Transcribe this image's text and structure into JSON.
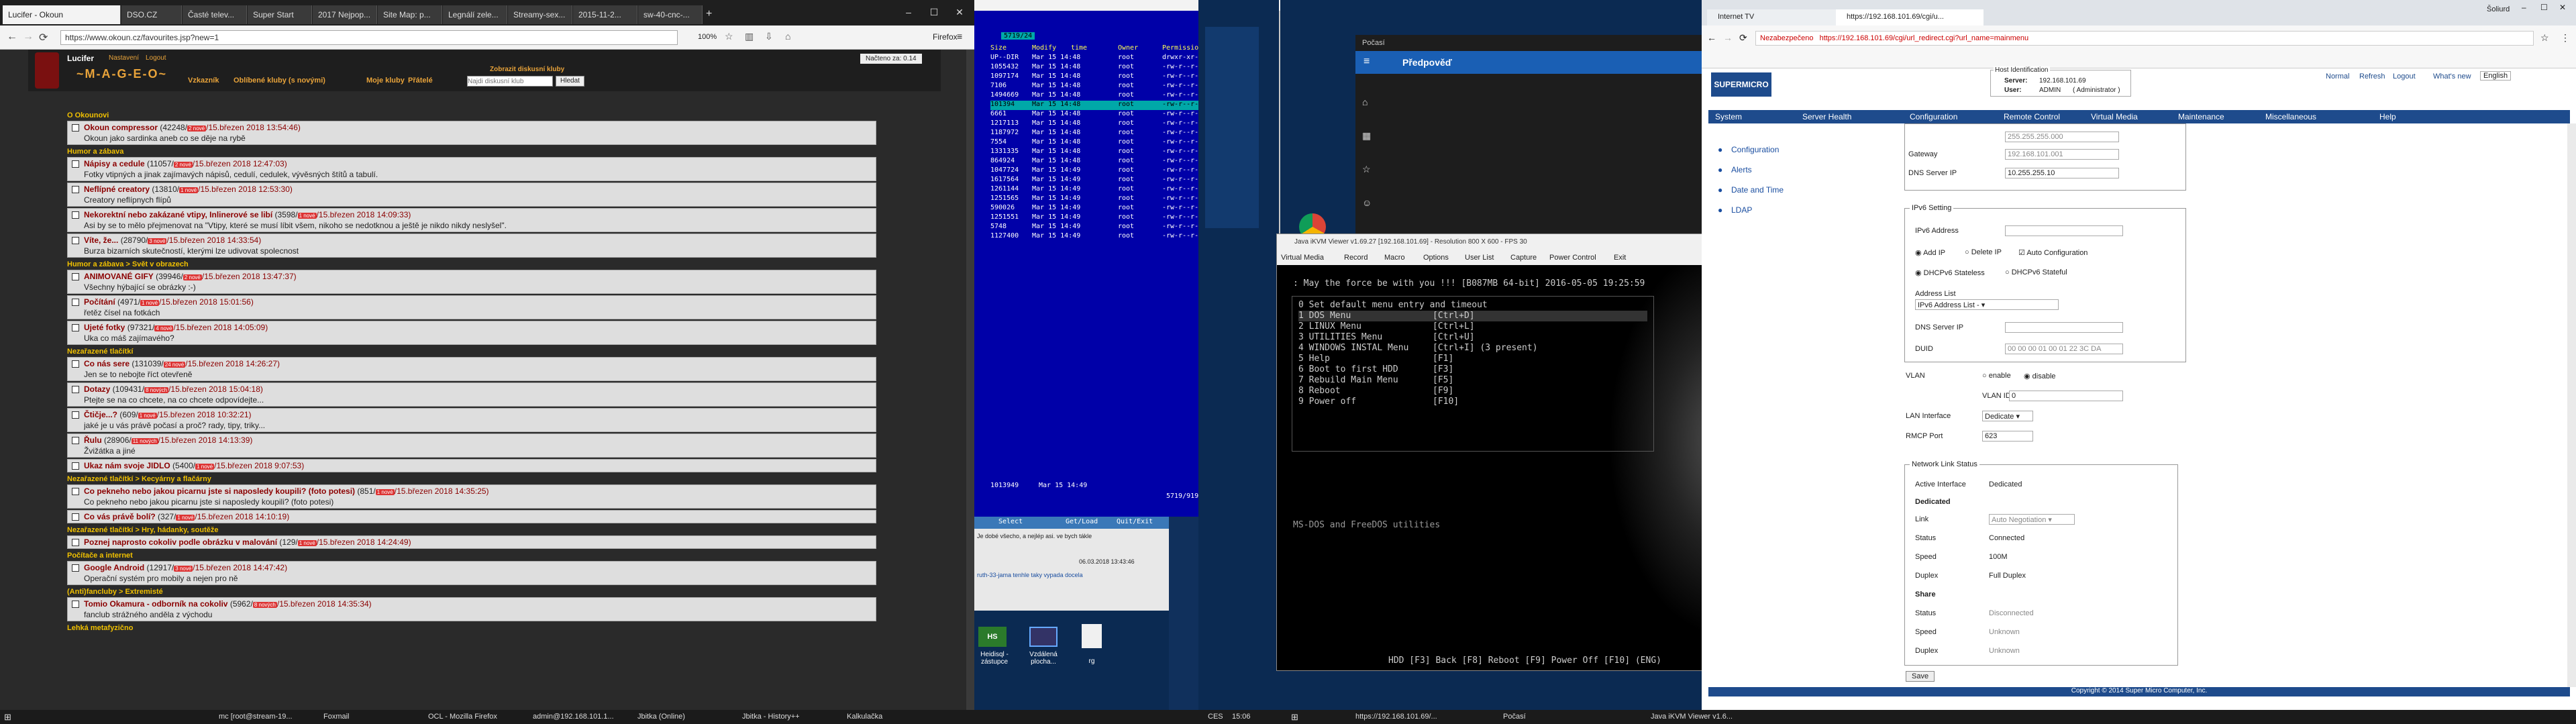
{
  "colors": {
    "okoun_bg": "#2a2a2a",
    "fm_blue": "#0000a8",
    "fm_cyan": "#00a8a8",
    "kvm_bg": "#000000",
    "sm_nav": "#1e4b8c",
    "accent": "#d33"
  },
  "ff1": {
    "tabs": [
      "Lucifer - Okoun",
      "DSO.CZ",
      "Časté telev...",
      "Super Start",
      "2017 Nejpop...",
      "Site Map: p...",
      "Legnálí zele...",
      "Streamy-sex...",
      "2015-11-2...",
      "sw-40-cnc-..."
    ],
    "url": "https://www.okoun.cz/favourites.jsp?new=1",
    "zoom": "100%",
    "toolbar_right": "Firefox",
    "user": "Lucifer",
    "logo": "~M-A-G-E-O~",
    "top_links": [
      "Nastavení",
      "Logout"
    ],
    "menu": [
      "Vzkazník",
      "Oblíbené kluby (s novými)",
      "Moje kluby",
      "Přátelé"
    ],
    "search_title": "Zobrazit diskusní kluby",
    "search_placeholder": "Najdi diskusní klub",
    "search_btn": "Hledat",
    "status_right": "Načteno za: 0.14",
    "sections": [
      {
        "title": "O Okounovi",
        "items": [
          {
            "name": "Okoun compressor",
            "meta": "(42248/",
            "new": "2 nové",
            "date": "/15.březen 2018 13:54:46)",
            "desc": "Okoun jako sardinka aneb co se děje na rybě"
          }
        ]
      },
      {
        "title": "Humor a zábava",
        "items": [
          {
            "name": "Nápisy a cedule",
            "meta": "(11057/",
            "new": "2 nové",
            "date": "/15.březen 2018 12:47:03)",
            "desc": "Fotky vtipných a jinak zajímavých nápisů, cedulí, cedulek, vývěsných štítů a tabulí."
          },
          {
            "name": "Neflípné creatory",
            "meta": "(13810/",
            "new": "1 nové",
            "date": "/15.březen 2018 12:53:30)",
            "desc": "Creatory neflípnych flípů"
          },
          {
            "name": "Nekorektní nebo zakázané vtipy, Inlinerové se libí",
            "meta": "(3598/",
            "new": "1 nové",
            "date": "/15.březen 2018 14:09:33)",
            "desc": "Asi by se to mělo přejmenovat na \"Vtipy, které se musí líbit všem, nikoho se nedotknou a ještě je nikdo nikdy neslyšel\"."
          },
          {
            "name": "Víte, že...",
            "meta": "(28790/",
            "new": "3 nové",
            "date": "/15.březen 2018 14:33:54)",
            "desc": "Burza bizarních skutečností, kterými lze udivovat spolecnost"
          }
        ]
      },
      {
        "title": "Humor a zábava > Svět v obrazech",
        "items": [
          {
            "name": "ANIMOVANÉ GIFY",
            "meta": "(39946/",
            "new": "2 nové",
            "date": "/15.březen 2018 13:47:37)",
            "desc": "Všechny hýbající se obrázky :-)"
          },
          {
            "name": "Počítání",
            "meta": "(4971/",
            "new": "1 nové",
            "date": "/15.březen 2018 15:01:56)",
            "desc": "řetěz čísel na fotkách"
          },
          {
            "name": "Ujeté fotky",
            "meta": "(97321/",
            "new": "4 nové",
            "date": "/15.březen 2018 14:05:09)",
            "desc": "Uka co máš zajímavého?"
          }
        ]
      },
      {
        "title": "Nezařazené tlačítkí",
        "items": [
          {
            "name": "Co nás sere",
            "meta": "(131039/",
            "new": "24 nové",
            "date": "/15.březen 2018 14:26:27)",
            "desc": "Jen se to nebojte říct otevřeně"
          },
          {
            "name": "Dotazy",
            "meta": "(109431/",
            "new": "8 nových",
            "date": "/15.březen 2018 15:04:18)",
            "desc": "Ptejte se na co chcete, na co chcete odpovídejte..."
          },
          {
            "name": "Čtičje...?",
            "meta": "(609/",
            "new": "1 nové",
            "date": "/15.březen 2018 10:32:21)",
            "desc": "jaké je u vás právě počasí a proč? rady, tipy, triky..."
          },
          {
            "name": "Řulu",
            "meta": "(28906/",
            "new": "11 nových",
            "date": "/15.březen 2018 14:13:39)",
            "desc": "Žvižátka a jiné"
          },
          {
            "name": "Ukaz nám svoje JIDLO",
            "meta": "(5400/",
            "new": "1 nové",
            "date": "/15.březen 2018 9:07:53)",
            "desc": ""
          }
        ]
      },
      {
        "title": "Nezařazené tlačítkí > Kecyárny a flačárny",
        "items": [
          {
            "name": "Co pekneho nebo jakou picarnu jste si naposledy koupili? (foto potesi)",
            "meta": "(851/",
            "new": "1 nové",
            "date": "/15.březen 2018 14:35:25)",
            "desc": "Co pekneho nebo jakou picarnu jste si naposledy koupili? (foto potesi)"
          },
          {
            "name": "Co vás právě bolí?",
            "meta": "(327/",
            "new": "1 nové",
            "date": "/15.březen 2018 14:10:19)",
            "desc": ""
          }
        ]
      },
      {
        "title": "Nezařazené tlačítkí > Hry, hádanky, soutěže",
        "items": [
          {
            "name": "Poznej naprosto cokoliv podle obrázku v malování",
            "meta": "(129/",
            "new": "1 nové",
            "date": "/15.březen 2018 14:24:49)",
            "desc": ""
          }
        ]
      },
      {
        "title": "Počítače a internet",
        "items": [
          {
            "name": "Google Android",
            "meta": "(12917/",
            "new": "3 nové",
            "date": "/15.březen 2018 14:47:42)",
            "desc": "Operační systém pro mobily a nejen pro ně"
          }
        ]
      },
      {
        "title": "(Anti)fancluby > Extremisté",
        "items": [
          {
            "name": "Tomio Okamura - odborník na cokoliv",
            "meta": "(5962/",
            "new": "8 nových",
            "date": "/15.březen 2018 14:35:34)",
            "desc": "fanclub strážného anděla z východu"
          }
        ]
      },
      {
        "title": "Lehká metafyzično",
        "items": []
      }
    ]
  },
  "fm": {
    "header": [
      "Size",
      "Modify",
      "time",
      "Owner",
      "Permission"
    ],
    "subheader": [
      "UP--DIR",
      "Mar 15 14:48",
      "root",
      "drwxr-xr-x"
    ],
    "sizes": [
      "1055432",
      "1097174",
      "7106",
      "1494669",
      "101394",
      "6661",
      "1217113",
      "1187972",
      "7554",
      "1331335",
      "864924",
      "1047724",
      "1617564",
      "1261144",
      "1251565",
      "590026",
      "1251551",
      "5748",
      "1127400"
    ],
    "times": [
      "14:48",
      "14:48",
      "14:48",
      "14:48",
      "14:48",
      "14:48",
      "14:48",
      "14:48",
      "14:48",
      "14:48",
      "14:48",
      "14:49",
      "14:49",
      "14:49",
      "14:49",
      "14:49",
      "14:49",
      "14:49",
      "14:49"
    ],
    "owner": "root",
    "perm": "-rw-r--r--",
    "bottom_size": "1013949",
    "bottom_time": "Mar 15 14:49",
    "bottom_info": "5719/9196 (60%)",
    "panel_title": "5719/24"
  },
  "chat": {
    "line1": "Je dobé všecho, a nejlép asi. ve bych tákle",
    "date": "06.03.2018 13:43:46",
    "line2": "ruth-33-jama  tenhle taky vypada docela",
    "fkeys": [
      "Select",
      "Get/Load",
      "Quit/Exit"
    ]
  },
  "desktop": {
    "icons": [
      "Heidisql - zástupce",
      "Vzdálená plocha...",
      "rg"
    ]
  },
  "pocasi": {
    "app": "Počasí",
    "title": "Předpověď"
  },
  "kvm": {
    "title": "Java iKVM Viewer v1.69.27 [192.168.101.69] - Resolution 800 X 600 - FPS 30",
    "menu": [
      "Virtual Media",
      "Record",
      "Macro",
      "Options",
      "User List",
      "Capture",
      "Power Control",
      "Exit"
    ],
    "banner": ": May the force be with you !!! [B087MB 64-bit] 2016-05-05 19:25:59",
    "boot_header": "0 Set default menu entry and timeout",
    "boot_items": [
      [
        "1 DOS Menu",
        "[Ctrl+D]"
      ],
      [
        "2 LINUX Menu",
        "[Ctrl+L]"
      ],
      [
        "3 UTILITIES Menu",
        "[Ctrl+U]"
      ],
      [
        "4 WINDOWS INSTAL Menu",
        "[Ctrl+I] (3 present)"
      ],
      [
        "5 Help",
        "[F1]"
      ],
      [
        "6 Boot to first HDD",
        "[F3]"
      ],
      [
        "7 Rebuild Main Menu",
        "[F5]"
      ],
      [
        "8 Reboot",
        "[F9]"
      ],
      [
        "9 Power off",
        "[F10]"
      ]
    ],
    "footer_desc": "MS-DOS and FreeDOS utilities",
    "bottom_bar": "HDD [F3]    Back [F8]    Reboot [F9]    Power Off [F10]    (ENG)"
  },
  "ff2": {
    "tabs": [
      "Internet TV",
      "https://192.168.101.69/cgi/u..."
    ],
    "url": "https://192.168.101.69/cgi/url_redirect.cgi?url_name=mainmenu",
    "insecure": "Nezabezpečeno",
    "bookmark_user": "Šoliurd",
    "host_title": "Host Identification",
    "server_label": "Server:",
    "server": "192.168.101.69",
    "user_label": "User:",
    "user": "ADMIN",
    "role": "( Administrator )",
    "top_links": [
      "Normal",
      "Refresh",
      "Logout",
      "What's new",
      "English"
    ],
    "nav": [
      "System",
      "Server Health",
      "Configuration",
      "Remote Control",
      "Virtual Media",
      "Maintenance",
      "Miscellaneous",
      "Help"
    ],
    "left": [
      "Configuration",
      "Alerts",
      "Date and Time",
      "LDAP"
    ],
    "gateway_label": "Gateway",
    "gateway": "192.168.101.001",
    "dns_label": "DNS Server IP",
    "dns": "10.255.255.10",
    "subnet_value": "255.255.255.000",
    "ipv6_title": "IPv6 Setting",
    "ipv6_addr_label": "IPv6 Address",
    "add_ip": "Add IP",
    "delete_ip": "Delete IP",
    "auto_cfg": "Auto Configuration",
    "dhcpv6_stateless": "DHCPv6 Stateless",
    "dhcpv6_stateful": "DHCPv6 Stateful",
    "addr_list_label": "Address List",
    "addr_list": "IPv6 Address List -",
    "dns6_label": "DNS Server IP",
    "duid_label": "DUID",
    "duid": "00 00 00 01 00 01 22 3C DA",
    "vlan_label": "VLAN",
    "vlan_enable": "enable",
    "vlan_disable": "disable",
    "vlan_id_label": "VLAN ID",
    "vlan_id": "0",
    "lan_iface_label": "LAN Interface",
    "lan_iface": "Dedicate",
    "rmcp_label": "RMCP Port",
    "rmcp": "623",
    "nls_title": "Network Link Status",
    "active_if_label": "Active Interface",
    "active_if": "Dedicated",
    "dedicated": "Dedicated",
    "link_label": "Link",
    "link": "Auto Negotiation",
    "status_label": "Status",
    "status_dedicated": "Connected",
    "speed_label": "Speed",
    "speed_dedicated": "100M",
    "duplex_label": "Duplex",
    "duplex_dedicated": "Full Duplex",
    "share": "Share",
    "status_share": "Disconnected",
    "speed_share": "Unknown",
    "duplex_share": "Unknown",
    "save": "Save",
    "copyright": "Copyright © 2014 Super Micro Computer, Inc."
  },
  "taskbar1": {
    "items": [
      "mc [root@stream-19...",
      "Foxmail",
      "OCL - Mozilla Firefox",
      "admin@192.168.101.1...",
      "Jbitka (Online)",
      "Jbitka - History++",
      "Kalkulačka"
    ],
    "lang": "CES",
    "time": "15:06"
  },
  "taskbar2": {
    "items": [
      "https://192.168.101.69/...",
      "Počasí",
      "Java iKVM Viewer v1.6..."
    ]
  }
}
